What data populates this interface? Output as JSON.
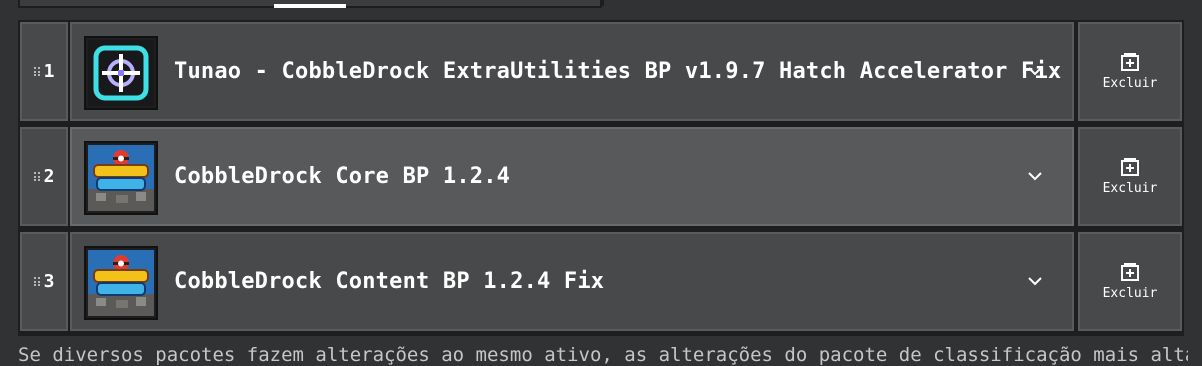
{
  "packs": [
    {
      "rank": "1",
      "title": "Tunao - CobbleDrock ExtraUtilities BP v1.9.7 Hatch Accelerator Fix",
      "icon": "crosshair-pack-icon",
      "delete_label": "Excluir"
    },
    {
      "rank": "2",
      "title": "CobbleDrock Core BP 1.2.4",
      "icon": "cobbledrock-logo-icon",
      "delete_label": "Excluir"
    },
    {
      "rank": "3",
      "title": "CobbleDrock Content BP 1.2.4 Fix",
      "icon": "cobbledrock-logo-icon",
      "delete_label": "Excluir"
    }
  ],
  "footer": {
    "text": "Se diversos pacotes fazem alterações ao mesmo ativo, as alterações do pacote de classificação mais alta"
  },
  "colors": {
    "background": "#313233",
    "row": "#48494a",
    "row_hover": "#58595a",
    "accent_cyan": "#3ee0e6"
  }
}
